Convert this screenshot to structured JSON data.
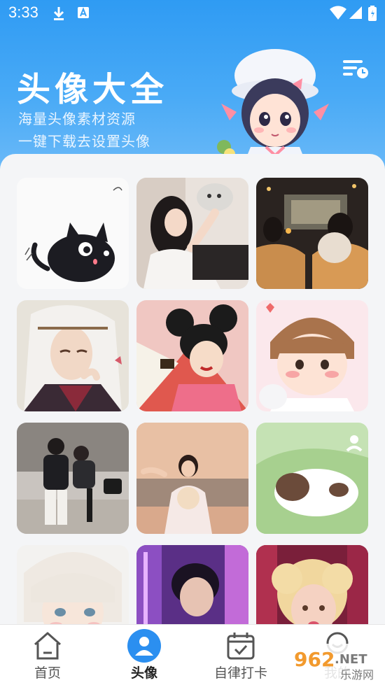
{
  "status_bar": {
    "time": "3:33"
  },
  "hero": {
    "title": "头像大全",
    "subtitle_1": "海量头像素材资源",
    "subtitle_2": "一键下载去设置头像"
  },
  "grid": {
    "tiles": [
      {
        "name": "cartoon-black-cat"
      },
      {
        "name": "girl-holding-cat"
      },
      {
        "name": "couple-outdoor-cinema"
      },
      {
        "name": "anime-white-hair-man"
      },
      {
        "name": "cartoon-princess"
      },
      {
        "name": "cartoon-boy-with-cat"
      },
      {
        "name": "couple-on-stairs"
      },
      {
        "name": "girl-sunset-flowers"
      },
      {
        "name": "cartoon-dog-on-grass"
      },
      {
        "name": "anime-white-hair-boy"
      },
      {
        "name": "boy-neon-background"
      },
      {
        "name": "curly-hair-girl"
      }
    ]
  },
  "bottom_nav": {
    "items": [
      {
        "label": "首页",
        "icon": "home-icon",
        "active": false
      },
      {
        "label": "头像",
        "icon": "avatar-icon",
        "active": true
      },
      {
        "label": "自律打卡",
        "icon": "calendar-check-icon",
        "active": false
      },
      {
        "label": "我的",
        "icon": "smile-icon",
        "active": false
      }
    ]
  },
  "watermark": {
    "text_1": "962",
    "text_2": ".NET",
    "text_3": "乐游网"
  },
  "colors": {
    "accent": "#2f9bf3",
    "nav_active": "#2b8ff0",
    "panel": "#f4f5f7"
  }
}
